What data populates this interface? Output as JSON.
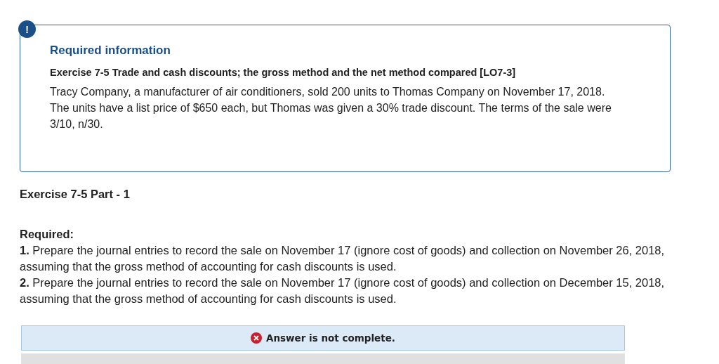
{
  "info_card": {
    "badge": "!",
    "title": "Required information",
    "subtitle": "Exercise 7-5 Trade and cash discounts; the gross method and the net method compared [LO7-3]",
    "body": "Tracy Company, a manufacturer of air conditioners, sold 200 units to Thomas Company on November 17, 2018. The units have a list price of $650 each, but Thomas was given a 30% trade discount. The terms of the sale were 3/10, n/30."
  },
  "part_title": "Exercise 7-5 Part - 1",
  "required": {
    "heading": "Required:",
    "items": [
      "**1.** Prepare the journal entries to record the sale on November 17 (ignore cost of goods) and collection on November 26, 2018, assuming that the gross method of accounting for cash discounts is used.",
      "**2.** Prepare the journal entries to record the sale on November 17 (ignore cost of goods) and collection on December 15, 2018, assuming that the gross method of accounting for cash discounts is used."
    ]
  },
  "answer_status": {
    "complete": false,
    "text": "Answer is not complete."
  }
}
